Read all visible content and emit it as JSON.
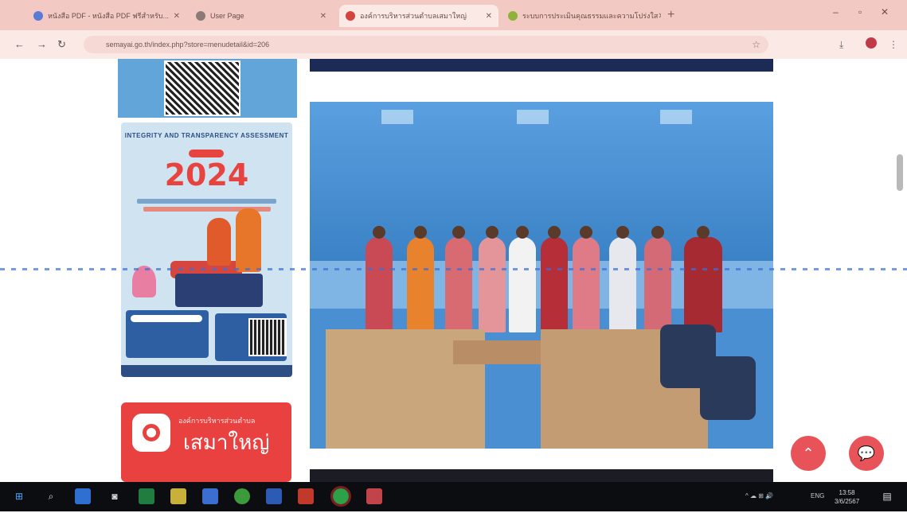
{
  "browser": {
    "tabs": [
      {
        "label": "หนังสือ PDF - หนังสือ PDF ฟรีสำหรับ...",
        "icon": "pdf-site-favicon",
        "active": false
      },
      {
        "label": "User Page",
        "icon": "globe-icon",
        "active": false
      },
      {
        "label": "องค์การบริหารส่วนตำบลเสมาใหญ่",
        "icon": "site-favicon",
        "active": true
      },
      {
        "label": "ระบบการประเมินคุณธรรมและความโปร่งใส",
        "icon": "site-favicon-2",
        "active": false
      }
    ],
    "new_tab": "+",
    "url": "semayai.go.th/index.php?store=menudetail&id=206",
    "window_controls": {
      "minimize": "–",
      "maximize": "▫",
      "close": "✕"
    }
  },
  "sidebar": {
    "poster": {
      "heading": "INTEGRITY AND TRANSPARENCY ASSESSMENT",
      "year": "2024"
    },
    "instagram": {
      "small_text": "องค์การบริหารส่วนตำบล",
      "big_text": "เสมาใหญ่"
    }
  },
  "fabs": {
    "scroll_top": "⌃",
    "chat": "💬"
  },
  "taskbar": {
    "clock_time": "13:58",
    "clock_date": "3/6/2567",
    "lang": "ENG",
    "tray": "^  ☁  ⊞  🔊"
  },
  "colors": {
    "tabbar": "#f3c9c4",
    "accent_red": "#e9413f",
    "photo_blue": "#4b8fd3",
    "taskbar": "#0b0d10"
  }
}
